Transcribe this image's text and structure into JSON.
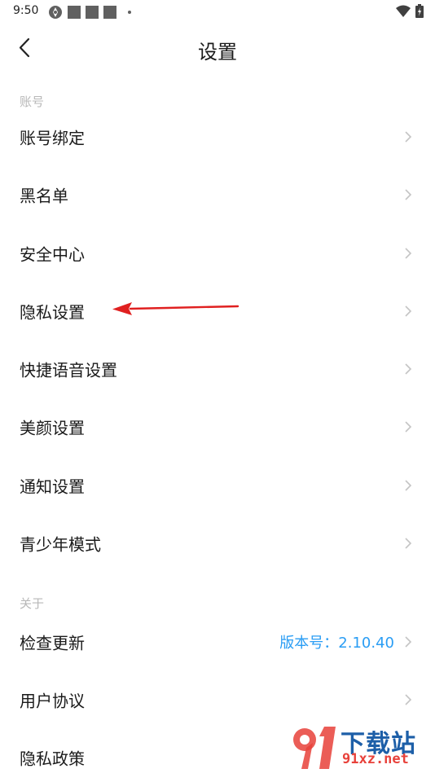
{
  "status_bar": {
    "time": "9:50"
  },
  "header": {
    "title": "设置"
  },
  "sections": {
    "account": {
      "label": "账号",
      "items": [
        {
          "label": "账号绑定"
        },
        {
          "label": "黑名单"
        },
        {
          "label": "安全中心"
        },
        {
          "label": "隐私设置"
        },
        {
          "label": "快捷语音设置"
        },
        {
          "label": "美颜设置"
        },
        {
          "label": "通知设置"
        },
        {
          "label": "青少年模式"
        }
      ]
    },
    "about": {
      "label": "关于",
      "items": [
        {
          "label": "检查更新",
          "value": "版本号：2.10.40"
        },
        {
          "label": "用户协议"
        },
        {
          "label": "隐私政策"
        }
      ]
    }
  },
  "watermark": {
    "top_text": "下载站",
    "bottom_text": "91xz.net"
  },
  "colors": {
    "accent": "#2a9df4",
    "section_label": "#b8b8b8",
    "chevron": "#c4c4c4",
    "annotation_arrow": "#e02020"
  },
  "icons": {
    "back": "chevron-left-icon",
    "row_arrow": "chevron-right-icon",
    "wifi": "wifi-icon",
    "battery": "battery-icon"
  }
}
